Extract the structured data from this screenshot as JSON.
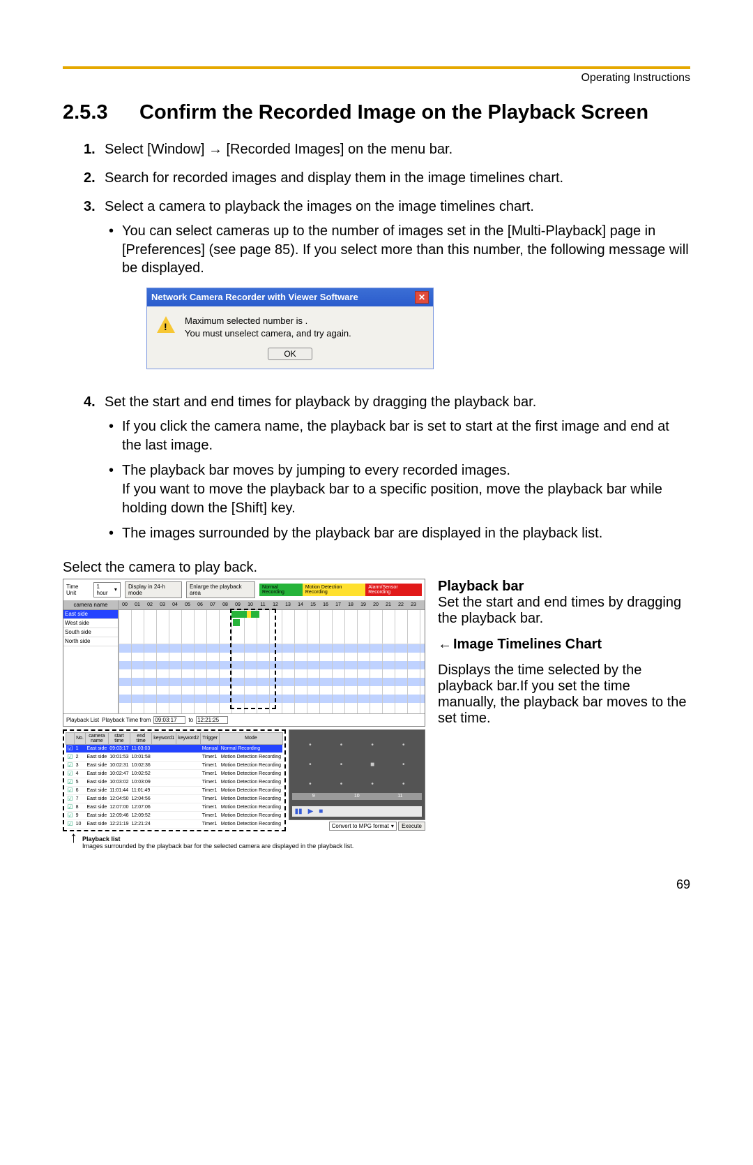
{
  "header": {
    "right": "Operating Instructions"
  },
  "section": {
    "number": "2.5.3",
    "title": "Confirm the Recorded Image on the Playback Screen"
  },
  "steps": {
    "s1": "Select [Window] → [Recorded Images] on the menu bar.",
    "s2": "Search for recorded images and display them in the image timelines chart.",
    "s3": "Select a camera to playback the images on the image timelines chart.",
    "s3b1": "You can select cameras up to the number of images set in the [Multi-Playback] page in [Preferences] (see page 85). If you select more than this number, the following message will be displayed.",
    "s4": "Set the start and end times for playback by dragging the playback bar.",
    "s4b1": "If you click the camera name, the playback bar is set to start at the first image and end at the last image.",
    "s4b2": "The playback bar moves by jumping to every recorded images.",
    "s4b2b": "If you want to move the playback bar to a specific position, move the playback bar while holding down the [Shift] key.",
    "s4b3": "The images surrounded by the playback bar are displayed in the playback list."
  },
  "dialog": {
    "title": "Network Camera Recorder with Viewer Software",
    "line1": "Maximum selected number is  .",
    "line2": "You must unselect camera, and try again.",
    "ok": "OK"
  },
  "captions": {
    "selectCamera": "Select the camera to play back.",
    "playbackBarTitle": "Playback bar",
    "playbackBarBody": "Set the start and end times by dragging the playback bar.",
    "chartTitle": "Image Timelines Chart",
    "chartBody": "Displays the time selected by the playback bar.If you set the time manually, the playback bar moves to the set time.",
    "playbackListTitle": "Playback list",
    "playbackListBody": "Images surrounded by the playback bar for the selected camera are displayed in the playback list."
  },
  "timelines": {
    "timeUnitLabel": "Time Unit",
    "timeUnitValue": "1 hour",
    "btn24h": "Display in 24-h mode",
    "btnEnlarge": "Enlarge the playback area",
    "legend": {
      "normal": "Normal Recording",
      "motion": "Motion Detection Recording",
      "alarm": "Alarm/Sensor Recording"
    },
    "camHeader": "camera name",
    "cams": [
      "East side",
      "West side",
      "South side",
      "North side"
    ],
    "hours": [
      "00",
      "01",
      "02",
      "03",
      "04",
      "05",
      "06",
      "07",
      "08",
      "09",
      "10",
      "11",
      "12",
      "13",
      "14",
      "15",
      "16",
      "17",
      "18",
      "19",
      "20",
      "21",
      "22",
      "23"
    ],
    "pbLabel": "Playback Time   from",
    "pbFrom": "09:03:17",
    "pbToLabel": "to",
    "pbTo": "12:21:25",
    "listLabel": "Playback List"
  },
  "playbackList": {
    "cols": [
      "",
      "No.",
      "camera name",
      "start time",
      "end time",
      "keyword1",
      "keyword2",
      "Trigger",
      "Mode"
    ],
    "rows": [
      {
        "no": "1",
        "cam": "East side",
        "st": "09:03:17",
        "et": "11:03:03",
        "tr": "Manual",
        "md": "Normal Recording",
        "sel": true
      },
      {
        "no": "2",
        "cam": "East side",
        "st": "10:01:53",
        "et": "10:01:58",
        "tr": "Timer1",
        "md": "Motion Detection Recording"
      },
      {
        "no": "3",
        "cam": "East side",
        "st": "10:02:31",
        "et": "10:02:36",
        "tr": "Timer1",
        "md": "Motion Detection Recording"
      },
      {
        "no": "4",
        "cam": "East side",
        "st": "10:02:47",
        "et": "10:02:52",
        "tr": "Timer1",
        "md": "Motion Detection Recording"
      },
      {
        "no": "5",
        "cam": "East side",
        "st": "10:03:02",
        "et": "10:03:09",
        "tr": "Timer1",
        "md": "Motion Detection Recording"
      },
      {
        "no": "6",
        "cam": "East side",
        "st": "11:01:44",
        "et": "11:01:49",
        "tr": "Timer1",
        "md": "Motion Detection Recording"
      },
      {
        "no": "7",
        "cam": "East side",
        "st": "12:04:50",
        "et": "12:04:56",
        "tr": "Timer1",
        "md": "Motion Detection Recording"
      },
      {
        "no": "8",
        "cam": "East side",
        "st": "12:07:00",
        "et": "12:07:06",
        "tr": "Timer1",
        "md": "Motion Detection Recording"
      },
      {
        "no": "9",
        "cam": "East side",
        "st": "12:09:46",
        "et": "12:09:52",
        "tr": "Timer1",
        "md": "Motion Detection Recording"
      },
      {
        "no": "10",
        "cam": "East side",
        "st": "12:21:19",
        "et": "12:21:24",
        "tr": "Timer1",
        "md": "Motion Detection Recording"
      }
    ]
  },
  "preview": {
    "markers": [
      "9",
      "10",
      "11"
    ],
    "convertLabel": "Convert to MPG format",
    "execute": "Execute"
  },
  "pageNumber": "69"
}
